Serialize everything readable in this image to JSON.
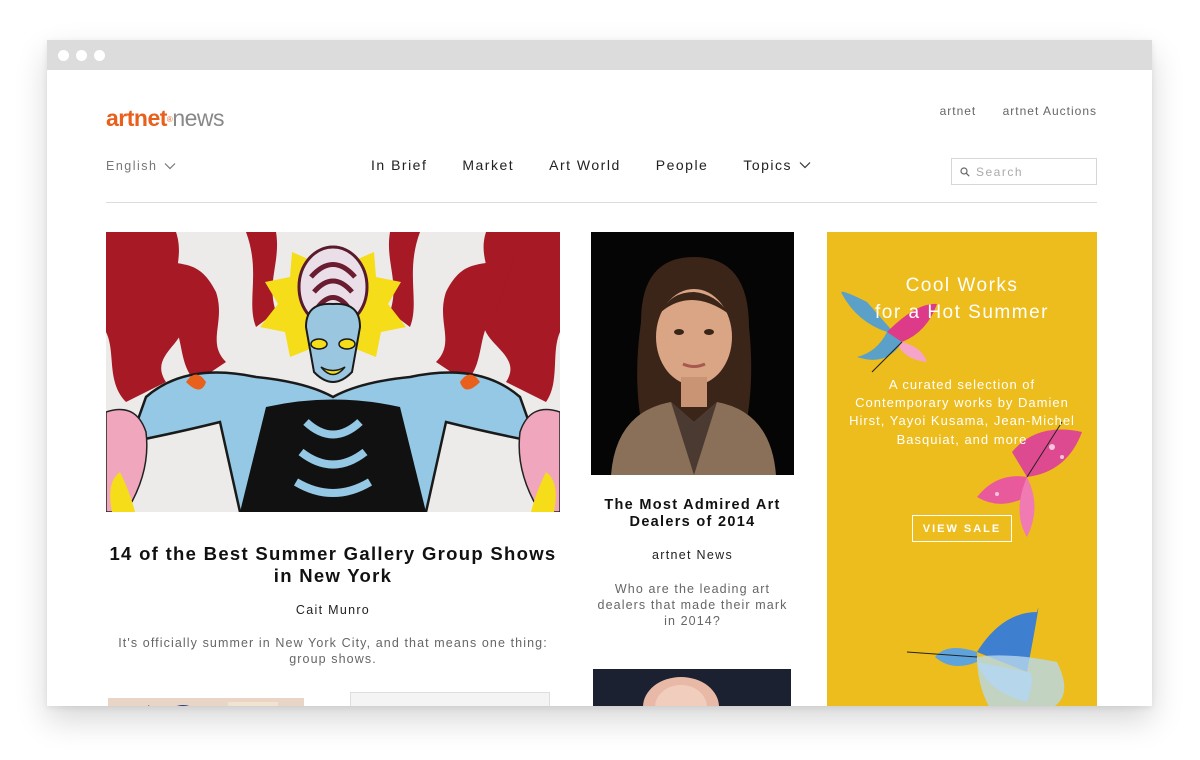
{
  "header": {
    "logo_brand": "artnet",
    "logo_mark": "®",
    "logo_suffix": "news",
    "top_links": [
      "artnet",
      "artnet Auctions"
    ],
    "language": "English"
  },
  "nav": {
    "items": [
      "In Brief",
      "Market",
      "Art World",
      "People",
      "Topics"
    ]
  },
  "search": {
    "placeholder": "Search"
  },
  "main_article": {
    "title": "14 of the Best Summer Gallery Group Shows in New York",
    "author": "Cait Munro",
    "excerpt": "It's officially summer in New York City, and that means one thing: group shows."
  },
  "side_article": {
    "title": "The Most Admired Art Dealers of 2014",
    "author": "artnet News",
    "excerpt": "Who are the leading art dealers that made their mark in 2014?"
  },
  "ad": {
    "title_line1": "Cool Works",
    "title_line2": "for a Hot Summer",
    "text": "A curated selection of Contemporary works by Damien Hirst, Yayoi Kusama, Jean-Michel Basquiat, and more",
    "button": "VIEW SALE"
  },
  "colors": {
    "brand_orange": "#e8601c",
    "ad_yellow": "#edbc1d"
  },
  "icons": [
    "chevron-down-icon",
    "search-icon"
  ]
}
